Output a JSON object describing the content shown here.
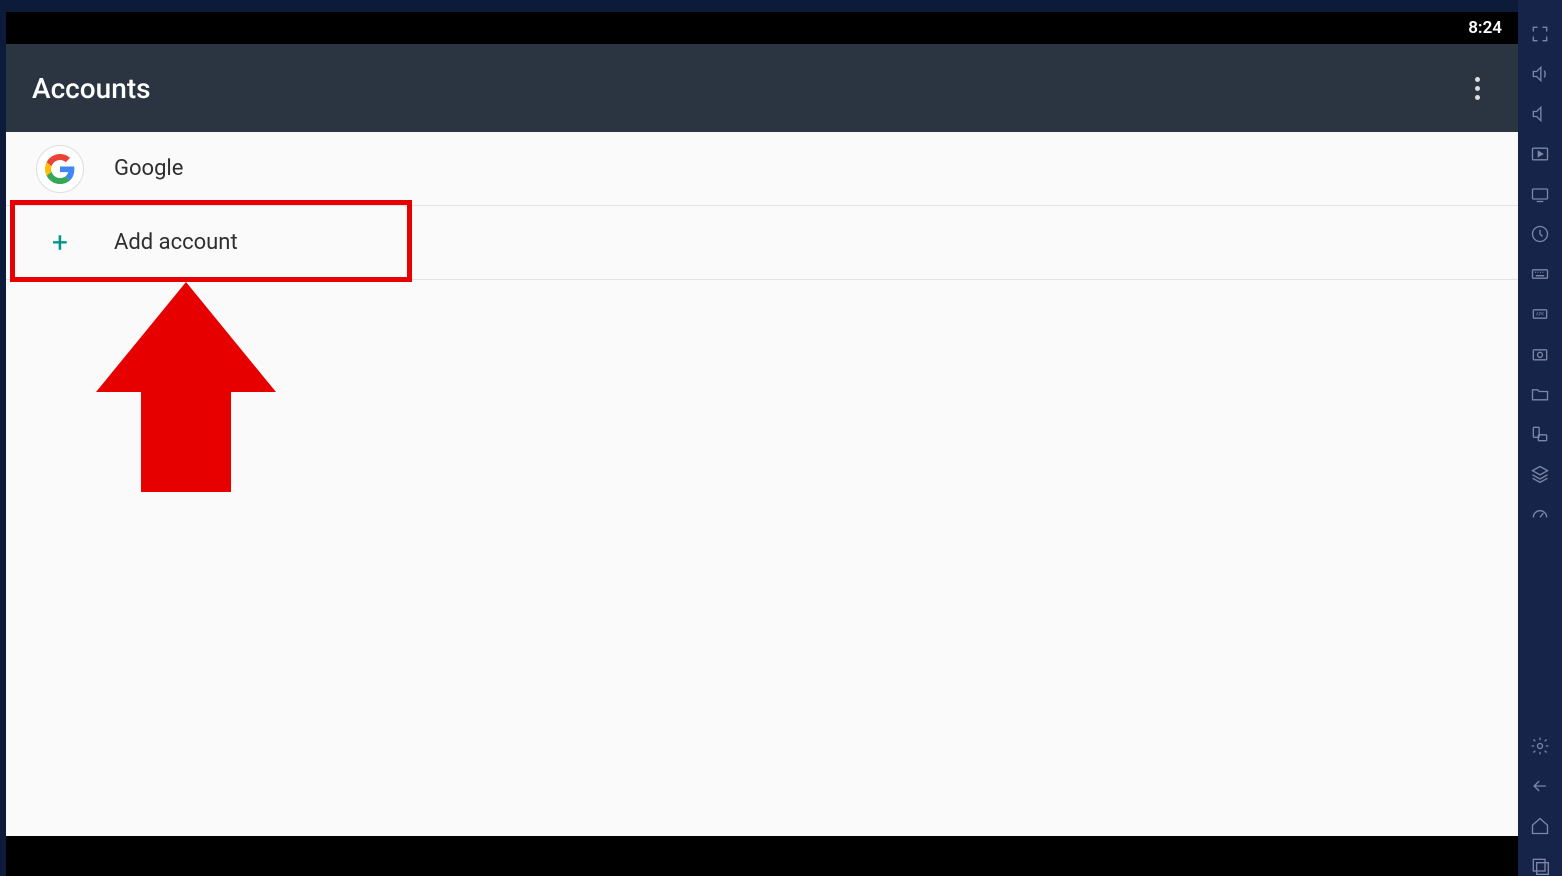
{
  "statusbar": {
    "time": "8:24"
  },
  "header": {
    "title": "Accounts"
  },
  "accounts": {
    "items": [
      {
        "icon": "google",
        "label": "Google"
      }
    ],
    "add_label": "Add account"
  },
  "sidebar": {
    "icons": [
      "fullscreen-icon",
      "volume-up-icon",
      "volume-down-icon",
      "play-in-frame-icon",
      "tv-icon",
      "clock-icon",
      "keyboard-icon",
      "apk-icon",
      "screenshot-icon",
      "folder-icon",
      "rotate-icon",
      "layers-icon",
      "speedometer-icon",
      "settings-icon",
      "back-icon",
      "home-icon",
      "recents-icon"
    ]
  }
}
